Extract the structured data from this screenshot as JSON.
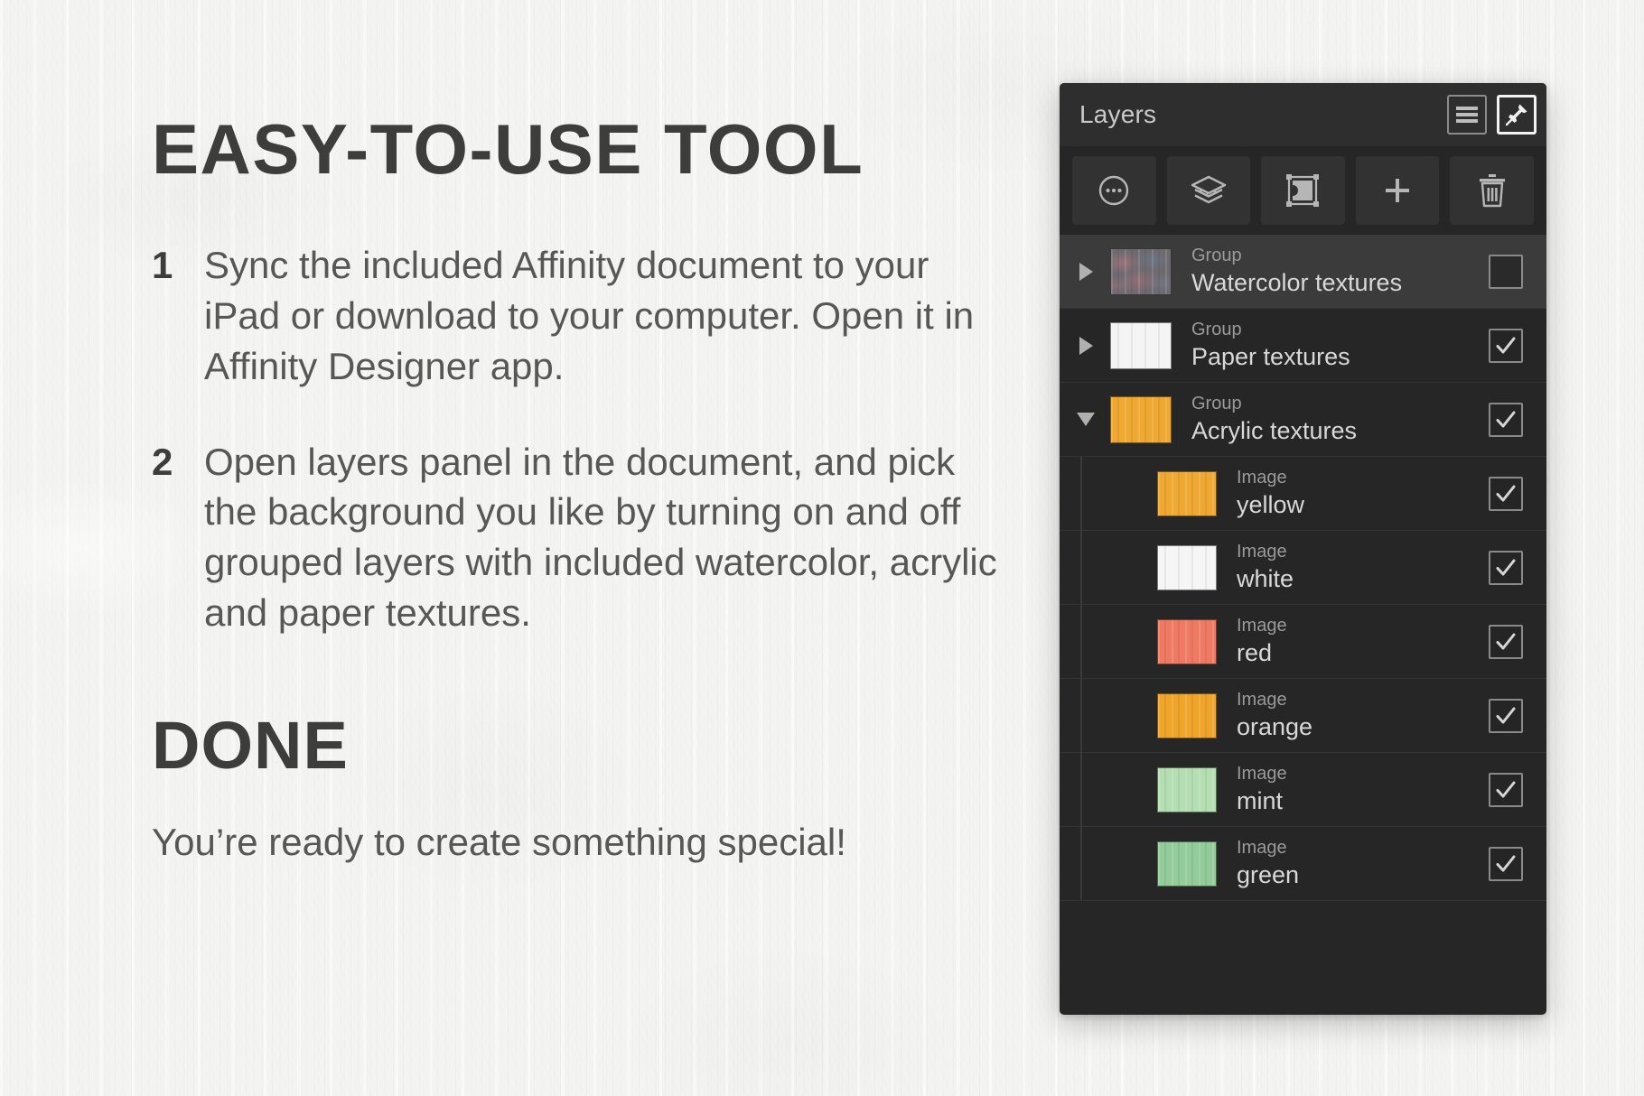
{
  "background": {
    "color": "#f3f3f1",
    "description": "white painted plaster wall texture"
  },
  "promo": {
    "headline": "EASY-TO-USE TOOL",
    "steps": [
      {
        "number": "1",
        "text": "Sync the included Affinity document to your iPad or download to your computer. Open it in Affinity Designer app."
      },
      {
        "number": "2",
        "text": "Open layers panel in the document, and pick the background you like by turning on and off grouped layers with included watercolor, acrylic and paper textures."
      }
    ],
    "done_heading": "DONE",
    "done_subtext": "You’re ready to create something special!",
    "text_color": "#575755",
    "heading_color": "#3d3d3b"
  },
  "layers_panel": {
    "title": "Layers",
    "panel_bg": "#262626",
    "header_bg": "#2e2e2e",
    "header_buttons": [
      {
        "name": "menu-icon",
        "label": "Panel menu",
        "active": false
      },
      {
        "name": "pin-icon",
        "label": "Pin panel",
        "active": true
      }
    ],
    "toolbar_buttons": [
      {
        "name": "more-options-icon",
        "label": "More options"
      },
      {
        "name": "layer-effects-icon",
        "label": "Layer effects"
      },
      {
        "name": "mask-layer-icon",
        "label": "Mask layer"
      },
      {
        "name": "add-layer-icon",
        "label": "Add layer"
      },
      {
        "name": "delete-layer-icon",
        "label": "Delete layer"
      }
    ],
    "rows": [
      {
        "kind": "Group",
        "name": "Watercolor textures",
        "level": 0,
        "expanded": false,
        "has_disclosure": true,
        "checked": false,
        "selected": true,
        "thumb_type": "watercolor",
        "thumb_color": "#6d6a70"
      },
      {
        "kind": "Group",
        "name": "Paper textures",
        "level": 0,
        "expanded": false,
        "has_disclosure": true,
        "checked": true,
        "selected": false,
        "thumb_type": "solid",
        "thumb_color": "#f4f4f4"
      },
      {
        "kind": "Group",
        "name": "Acrylic textures",
        "level": 0,
        "expanded": true,
        "has_disclosure": true,
        "checked": true,
        "selected": false,
        "thumb_type": "solid",
        "thumb_color": "#efa832"
      },
      {
        "kind": "Image",
        "name": "yellow",
        "level": 1,
        "expanded": false,
        "has_disclosure": false,
        "checked": true,
        "selected": false,
        "thumb_type": "solid",
        "thumb_color": "#efa832"
      },
      {
        "kind": "Image",
        "name": "white",
        "level": 1,
        "expanded": false,
        "has_disclosure": false,
        "checked": true,
        "selected": false,
        "thumb_type": "solid",
        "thumb_color": "#f5f5f5"
      },
      {
        "kind": "Image",
        "name": "red",
        "level": 1,
        "expanded": false,
        "has_disclosure": false,
        "checked": true,
        "selected": false,
        "thumb_type": "solid",
        "thumb_color": "#ee7a63"
      },
      {
        "kind": "Image",
        "name": "orange",
        "level": 1,
        "expanded": false,
        "has_disclosure": false,
        "checked": true,
        "selected": false,
        "thumb_type": "solid",
        "thumb_color": "#efa52a"
      },
      {
        "kind": "Image",
        "name": "mint",
        "level": 1,
        "expanded": false,
        "has_disclosure": false,
        "checked": true,
        "selected": false,
        "thumb_type": "solid",
        "thumb_color": "#b5dfb2"
      },
      {
        "kind": "Image",
        "name": "green",
        "level": 1,
        "expanded": false,
        "has_disclosure": false,
        "checked": true,
        "selected": false,
        "thumb_type": "solid",
        "thumb_color": "#93cb9b"
      }
    ]
  }
}
